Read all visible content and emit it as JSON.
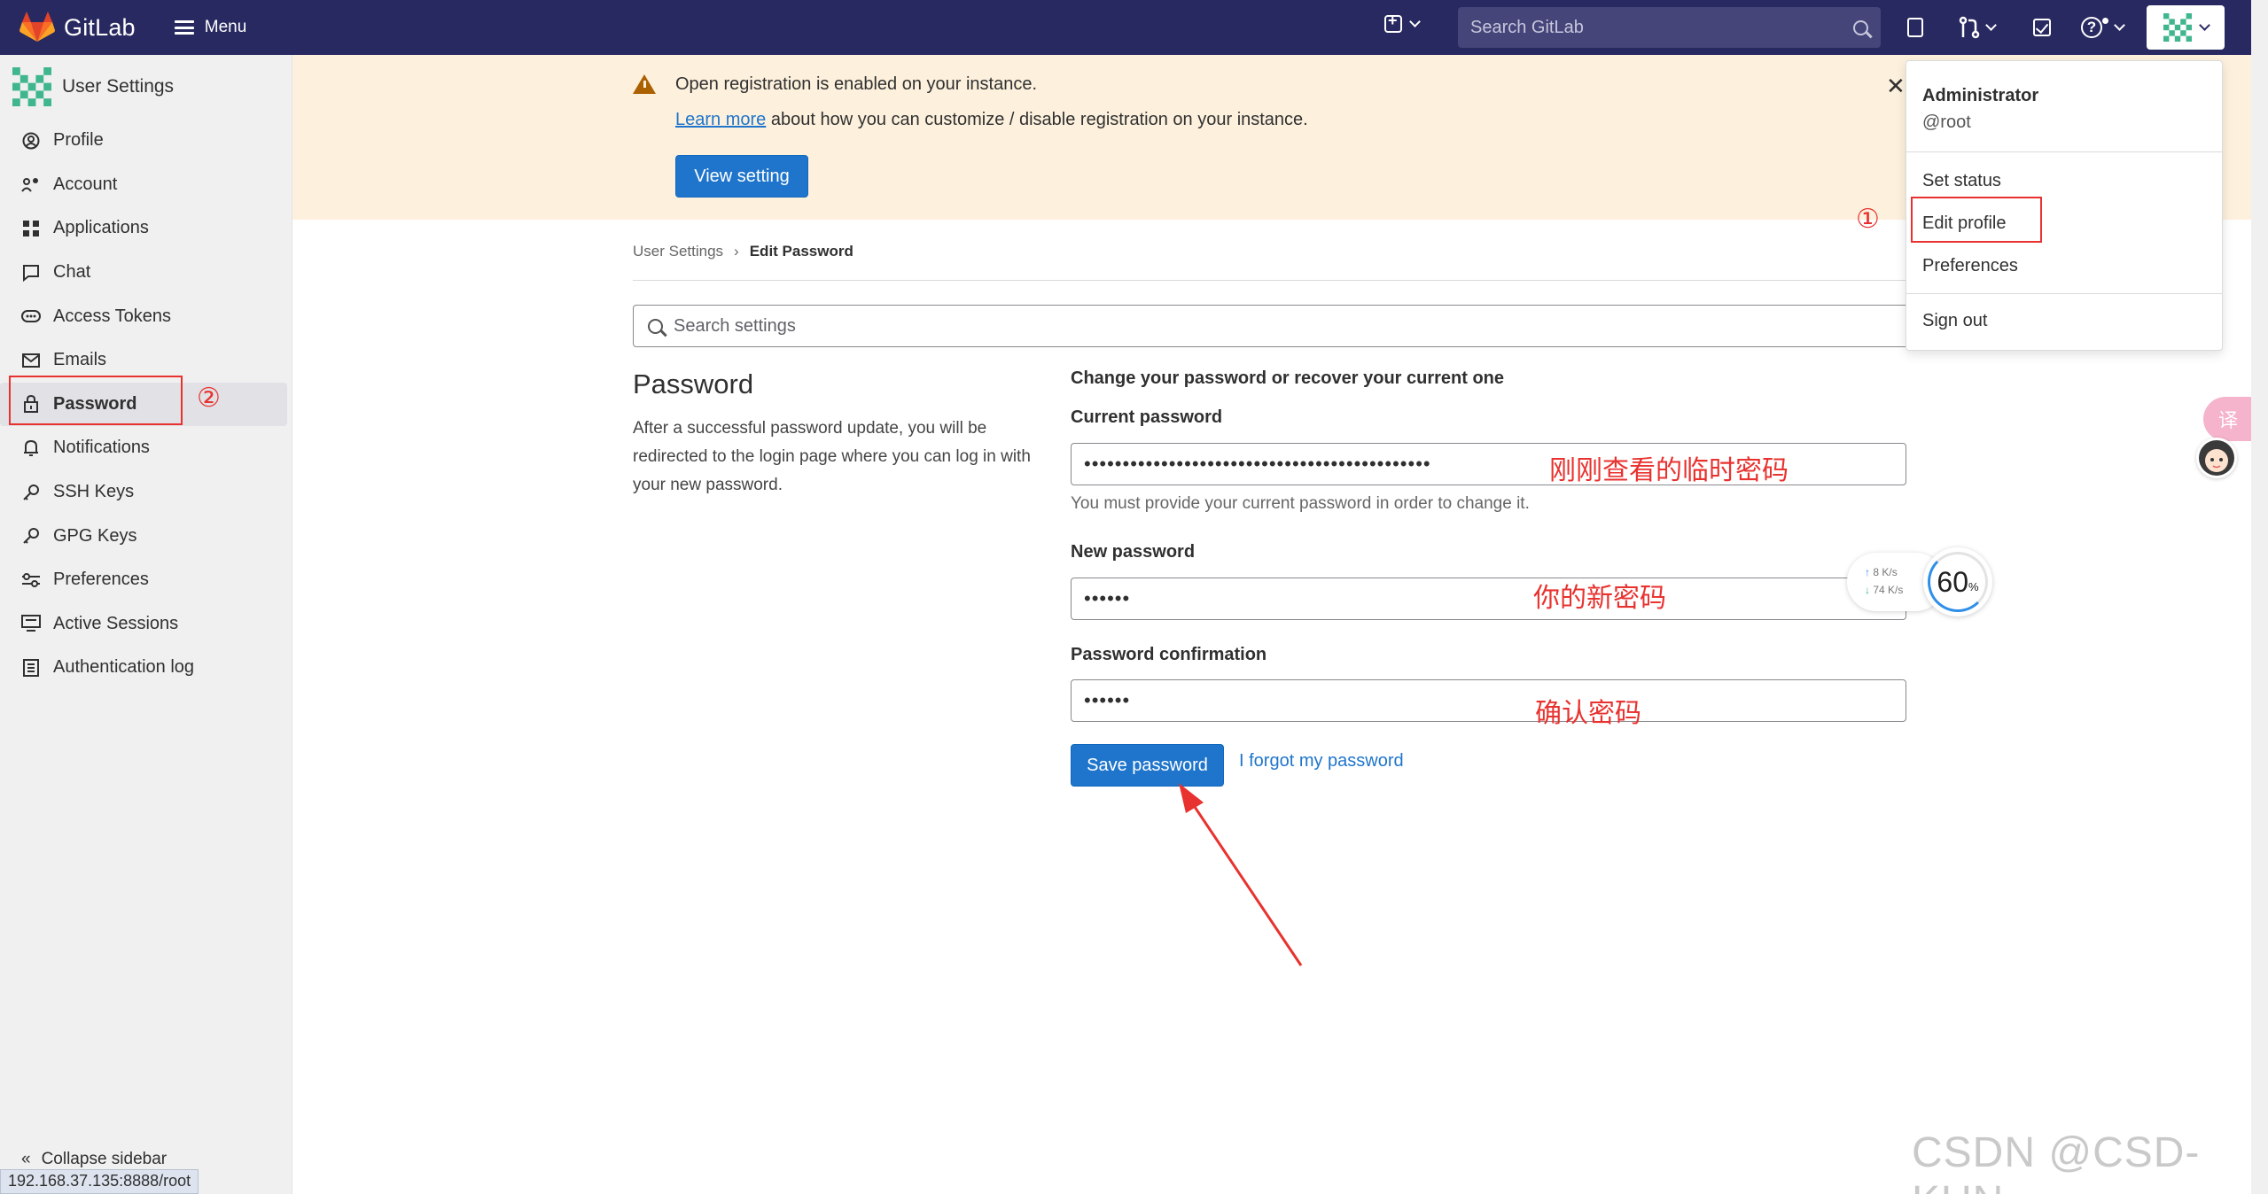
{
  "topbar": {
    "brand": "GitLab",
    "menu_label": "Menu",
    "search_placeholder": "Search GitLab",
    "bg_color": "#292961"
  },
  "sidebar": {
    "title": "User Settings",
    "items": [
      {
        "label": "Profile",
        "icon": "profile-icon"
      },
      {
        "label": "Account",
        "icon": "account-icon"
      },
      {
        "label": "Applications",
        "icon": "applications-icon"
      },
      {
        "label": "Chat",
        "icon": "chat-icon"
      },
      {
        "label": "Access Tokens",
        "icon": "token-icon"
      },
      {
        "label": "Emails",
        "icon": "mail-icon"
      },
      {
        "label": "Password",
        "icon": "lock-icon",
        "active": true
      },
      {
        "label": "Notifications",
        "icon": "bell-icon"
      },
      {
        "label": "SSH Keys",
        "icon": "key-icon"
      },
      {
        "label": "GPG Keys",
        "icon": "key-icon"
      },
      {
        "label": "Preferences",
        "icon": "preferences-icon"
      },
      {
        "label": "Active Sessions",
        "icon": "monitor-icon"
      },
      {
        "label": "Authentication log",
        "icon": "log-icon"
      }
    ],
    "collapse_label": "Collapse sidebar",
    "annotation": "②"
  },
  "banner": {
    "title": "Open registration is enabled on your instance.",
    "link": "Learn more",
    "body": " about how you can customize / disable registration on your instance.",
    "button": "View setting",
    "bg_color": "#fdf1dd"
  },
  "breadcrumb": {
    "parent": "User Settings",
    "current": "Edit Password"
  },
  "search_settings_placeholder": "Search settings",
  "section": {
    "title": "Password",
    "description": "After a successful password update, you will be redirected to the login page where you can log in with your new password."
  },
  "form": {
    "intro": "Change your password or recover your current one",
    "current_label": "Current password",
    "current_value": "•••••••••••••••••••••••••••••••••••••••••••••",
    "current_help": "You must provide your current password in order to change it.",
    "current_note": "刚刚查看的临时密码",
    "new_label": "New password",
    "new_value": "••••••",
    "new_note": "你的新密码",
    "confirm_label": "Password confirmation",
    "confirm_value": "••••••",
    "confirm_note": "确认密码",
    "save_button": "Save password",
    "forgot_link": "I forgot my password"
  },
  "dropdown": {
    "name": "Administrator",
    "username": "@root",
    "items": [
      "Set status",
      "Edit profile",
      "Preferences",
      "Sign out"
    ],
    "annotation": "①"
  },
  "speed_widget": {
    "up": "8",
    "down": "74",
    "unit": "K/s",
    "percent": "60",
    "percent_sign": "%"
  },
  "status_url": "192.168.37.135:8888/root",
  "watermark": "CSDN @CSD-KUN",
  "colors": {
    "accent": "#1f75cb",
    "annotation": "#e8322f"
  }
}
